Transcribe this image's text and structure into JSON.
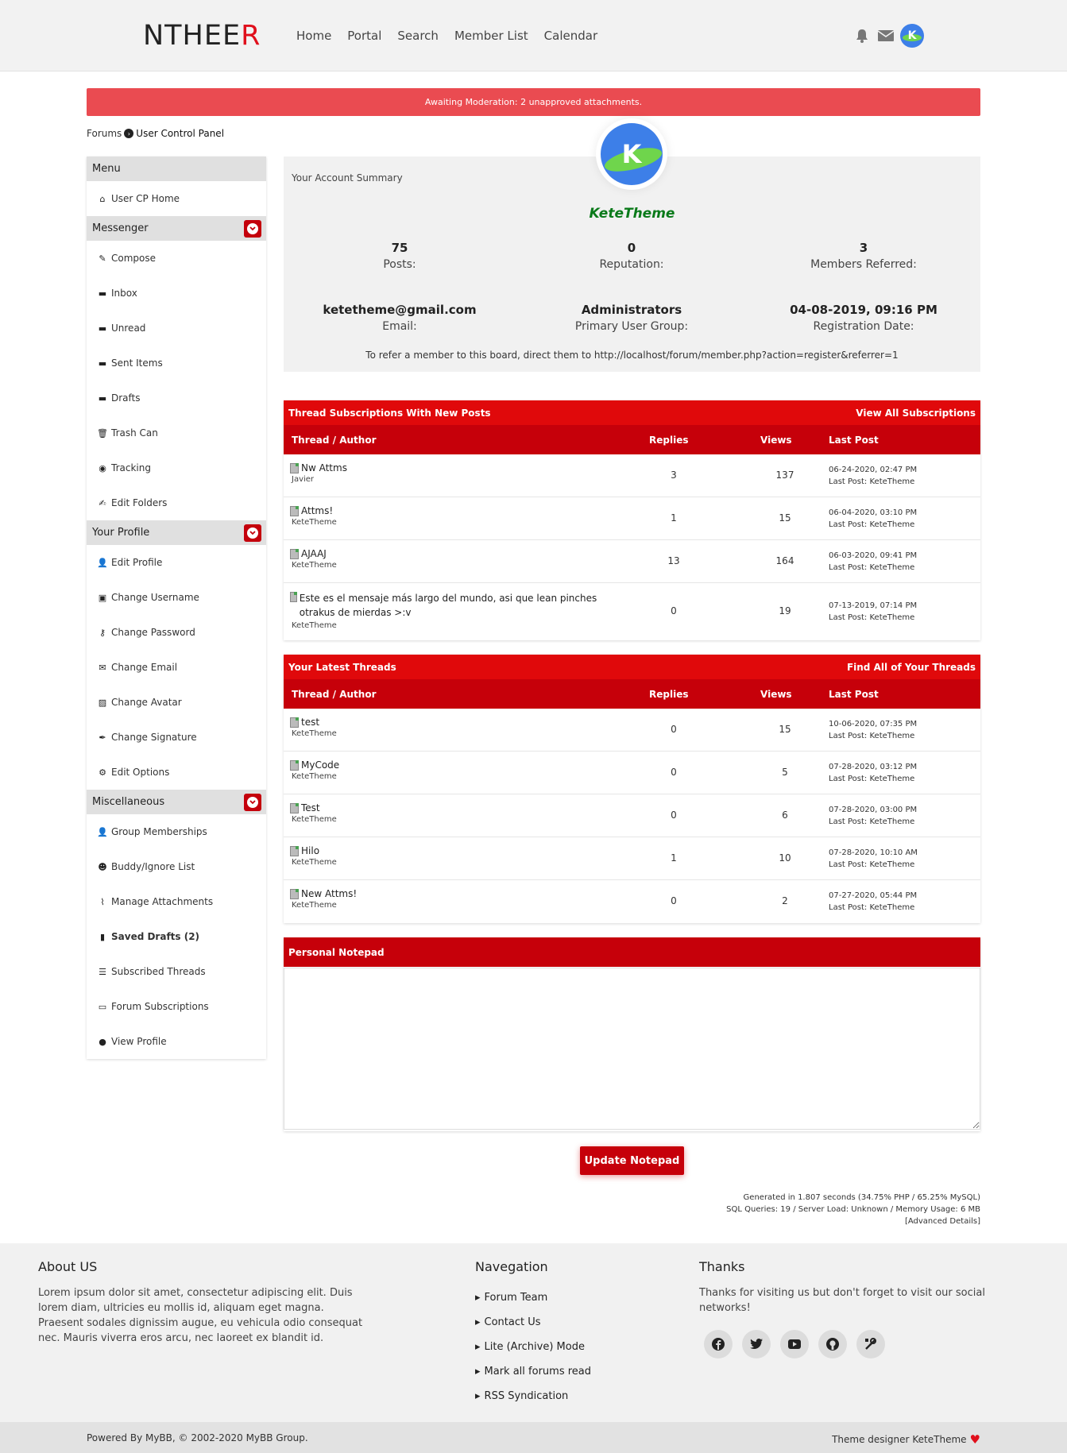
{
  "brand": {
    "logo_prefix": "NTHEE",
    "logo_suffix": "R"
  },
  "nav": [
    "Home",
    "Portal",
    "Search",
    "Member List",
    "Calendar"
  ],
  "header_icons": {
    "bell": "bell-icon",
    "mail": "mail-icon",
    "avatar_letter": "K"
  },
  "alert": "Awaiting Moderation: 2 unapproved attachments.",
  "breadcrumb": {
    "root": "Forums",
    "current": "User Control Panel"
  },
  "sidebar": {
    "menu_title": "Menu",
    "home": "User CP Home",
    "messenger_title": "Messenger",
    "messenger": [
      "Compose",
      "Inbox",
      "Unread",
      "Sent Items",
      "Drafts",
      "Trash Can",
      "Tracking",
      "Edit Folders"
    ],
    "profile_title": "Your Profile",
    "profile": [
      "Edit Profile",
      "Change Username",
      "Change Password",
      "Change Email",
      "Change Avatar",
      "Change Signature",
      "Edit Options"
    ],
    "misc_title": "Miscellaneous",
    "misc": [
      "Group Memberships",
      "Buddy/Ignore List",
      "Manage Attachments",
      "Saved Drafts (2)",
      "Subscribed Threads",
      "Forum Subscriptions",
      "View Profile"
    ]
  },
  "summary": {
    "title": "Your Account Summary",
    "avatar_letter": "K",
    "username": "KeteTheme",
    "posts_value": "75",
    "posts_label": "Posts:",
    "rep_value": "0",
    "rep_label": "Reputation:",
    "ref_value": "3",
    "ref_label": "Members Referred:",
    "email_value": "ketetheme@gmail.com",
    "email_label": "Email:",
    "group_value": "Administrators",
    "group_label": "Primary User Group:",
    "reg_value": "04-08-2019, 09:16 PM",
    "reg_label": "Registration Date:",
    "refer_text": "To refer a member to this board, direct them to http://localhost/forum/member.php?action=register&referrer=1"
  },
  "subscriptions": {
    "title": "Thread Subscriptions With New Posts",
    "link": "View All Subscriptions",
    "cols": {
      "thread": "Thread / Author",
      "replies": "Replies",
      "views": "Views",
      "last": "Last Post"
    },
    "rows": [
      {
        "title": "Nw Attms",
        "author": "Javier",
        "replies": "3",
        "views": "137",
        "date": "06-24-2020, 02:47 PM",
        "last": "Last Post: KeteTheme"
      },
      {
        "title": "Attms!",
        "author": "KeteTheme",
        "replies": "1",
        "views": "15",
        "date": "06-04-2020, 03:10 PM",
        "last": "Last Post: KeteTheme"
      },
      {
        "title": "AJAAJ",
        "author": "KeteTheme",
        "replies": "13",
        "views": "164",
        "date": "06-03-2020, 09:41 PM",
        "last": "Last Post: KeteTheme"
      },
      {
        "title": "Este es el mensaje más largo del mundo, asi que lean pinches otrakus de mierdas >:v",
        "author": "KeteTheme",
        "replies": "0",
        "views": "19",
        "date": "07-13-2019, 07:14 PM",
        "last": "Last Post: KeteTheme"
      }
    ]
  },
  "latest": {
    "title": "Your Latest Threads",
    "link": "Find All of Your Threads",
    "cols": {
      "thread": "Thread / Author",
      "replies": "Replies",
      "views": "Views",
      "last": "Last Post"
    },
    "rows": [
      {
        "title": "test",
        "author": "KeteTheme",
        "replies": "0",
        "views": "15",
        "date": "10-06-2020, 07:35 PM",
        "last": "Last Post: KeteTheme"
      },
      {
        "title": "MyCode",
        "author": "KeteTheme",
        "replies": "0",
        "views": "5",
        "date": "07-28-2020, 03:12 PM",
        "last": "Last Post: KeteTheme"
      },
      {
        "title": "Test",
        "author": "KeteTheme",
        "replies": "0",
        "views": "6",
        "date": "07-28-2020, 03:00 PM",
        "last": "Last Post: KeteTheme"
      },
      {
        "title": "Hilo",
        "author": "KeteTheme",
        "replies": "1",
        "views": "10",
        "date": "07-28-2020, 10:10 AM",
        "last": "Last Post: KeteTheme"
      },
      {
        "title": "New Attms!",
        "author": "KeteTheme",
        "replies": "0",
        "views": "2",
        "date": "07-27-2020, 05:44 PM",
        "last": "Last Post: KeteTheme"
      }
    ]
  },
  "notepad": {
    "title": "Personal Notepad",
    "value": "",
    "button": "Update Notepad"
  },
  "debug": {
    "line1": "Generated in 1.807 seconds (34.75% PHP / 65.25% MySQL)",
    "line2": "SQL Queries: 19 / Server Load: Unknown / Memory Usage: 6 MB",
    "line3": "[Advanced Details]"
  },
  "footer": {
    "about_title": "About US",
    "about_text": "Lorem ipsum dolor sit amet, consectetur adipiscing elit. Duis lorem diam, ultricies eu mollis id, aliquam eget magna. Praesent sodales dignissim augue, eu vehicula odio consequat nec. Mauris viverra eros arcu, nec laoreet ex blandit id.",
    "nav_title": "Navegation",
    "nav_links": [
      "Forum Team",
      "Contact Us",
      "Lite (Archive) Mode",
      "Mark all forums read",
      "RSS Syndication"
    ],
    "thanks_title": "Thanks",
    "thanks_text": "Thanks for visiting us but don't forget to visit our social networks!",
    "socials": [
      "facebook-icon",
      "twitter-icon",
      "youtube-icon",
      "github-icon",
      "tools-icon"
    ]
  },
  "bottom": {
    "powered": "Powered By MyBB, © 2002-2020 MyBB Group.",
    "designer_label": "Theme designer",
    "designer_name": "KeteTheme"
  },
  "colors": {
    "accent": "#c6000a",
    "accent_bright": "#e0090b",
    "alert": "#ea4b51",
    "username": "#0a7a1a"
  }
}
